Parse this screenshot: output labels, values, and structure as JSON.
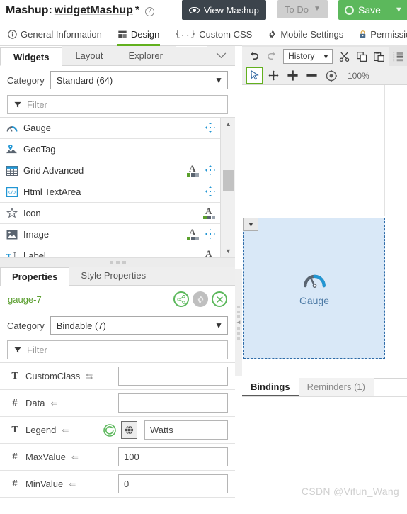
{
  "topbar": {
    "title_prefix": "Mashup:",
    "title_name": "widgetMashup",
    "title_modified": "*",
    "help_icon": "?",
    "view_mashup_label": "View Mashup",
    "todo_label": "To Do",
    "save_label": "Save"
  },
  "nav_tabs": [
    {
      "label": "General Information",
      "icon": "info-icon",
      "active": false
    },
    {
      "label": "Design",
      "icon": "design-icon",
      "active": true
    },
    {
      "label": "Custom CSS",
      "icon": "css-icon",
      "active": false
    },
    {
      "label": "Mobile Settings",
      "icon": "gear-icon",
      "active": false
    },
    {
      "label": "Permissions",
      "icon": "lock-icon",
      "active": false
    }
  ],
  "left_panel": {
    "tabs": [
      {
        "label": "Widgets",
        "active": true
      },
      {
        "label": "Layout",
        "active": false
      },
      {
        "label": "Explorer",
        "active": false
      }
    ],
    "collapse_chevron": "⌄",
    "category_label": "Category",
    "category_value": "Standard (64)",
    "filter_placeholder": "Filter",
    "widgets": [
      {
        "name": "Gauge",
        "icon": "gauge-icon",
        "has_style_badge": false,
        "has_move": true
      },
      {
        "name": "GeoTag",
        "icon": "geotag-icon",
        "has_style_badge": false,
        "has_move": false
      },
      {
        "name": "Grid Advanced",
        "icon": "grid-icon",
        "has_style_badge": true,
        "has_move": true
      },
      {
        "name": "Html TextArea",
        "icon": "html-textarea-icon",
        "has_style_badge": false,
        "has_move": true
      },
      {
        "name": "Icon",
        "icon": "star-icon",
        "has_style_badge": true,
        "has_move": false
      },
      {
        "name": "Image",
        "icon": "image-icon",
        "has_style_badge": true,
        "has_move": true
      },
      {
        "name": "Label",
        "icon": "label-icon",
        "has_style_badge": true,
        "has_move": false
      }
    ]
  },
  "properties_panel": {
    "tabs": [
      {
        "label": "Properties",
        "active": true
      },
      {
        "label": "Style Properties",
        "active": false
      }
    ],
    "widget_id": "gauge-7",
    "actions": [
      {
        "name": "share-button",
        "icon": "share-icon"
      },
      {
        "name": "settings-button",
        "icon": "gear-icon"
      },
      {
        "name": "close-button",
        "icon": "close-icon"
      }
    ],
    "category_label": "Category",
    "category_value": "Bindable (7)",
    "filter_placeholder": "Filter",
    "rows": [
      {
        "type_icon": "T",
        "name": "CustomClass",
        "binding_arrow": "⇆",
        "value": "",
        "has_refresh": false,
        "has_globe": false
      },
      {
        "type_icon": "#",
        "name": "Data",
        "binding_arrow": "⇐",
        "value": "",
        "has_refresh": false,
        "has_globe": false
      },
      {
        "type_icon": "T",
        "name": "Legend",
        "binding_arrow": "⇐",
        "value": "Watts",
        "has_refresh": true,
        "has_globe": true
      },
      {
        "type_icon": "#",
        "name": "MaxValue",
        "binding_arrow": "⇐",
        "value": "100",
        "has_refresh": false,
        "has_globe": false
      },
      {
        "type_icon": "#",
        "name": "MinValue",
        "binding_arrow": "⇐",
        "value": "0",
        "has_refresh": false,
        "has_globe": false
      }
    ]
  },
  "canvas_toolbar": {
    "undo_icon": "undo-icon",
    "redo_icon": "redo-icon",
    "history_label": "History",
    "cut_icon": "cut-icon",
    "copy_icon": "copy-icon",
    "paste_icon": "paste-icon",
    "align_icon": "align-icon",
    "select_icon": "cursor-select-icon",
    "pan_icon": "pan-move-icon",
    "zoom_in_icon": "zoom-in-icon",
    "zoom_out_icon": "zoom-out-icon",
    "reset_zoom_icon": "target-center-icon",
    "zoom_level": "100%"
  },
  "canvas": {
    "selected_widget_label": "Gauge",
    "selected_widget_icon": "gauge-icon",
    "handle_icon": "chevron-down-icon"
  },
  "bottom_tabs": [
    {
      "label": "Bindings",
      "active": true
    },
    {
      "label": "Reminders (1)",
      "active": false
    }
  ],
  "watermark": "CSDN @Vifun_Wang",
  "colors": {
    "accent_green": "#62b01e",
    "save_green": "#5cb85c",
    "dark_button": "#3c444c",
    "widget_blue": "#d9e8f7",
    "widget_border_blue": "#2d6ba8",
    "icon_blue": "#2196d4",
    "label_blue": "#4e7ba6"
  }
}
